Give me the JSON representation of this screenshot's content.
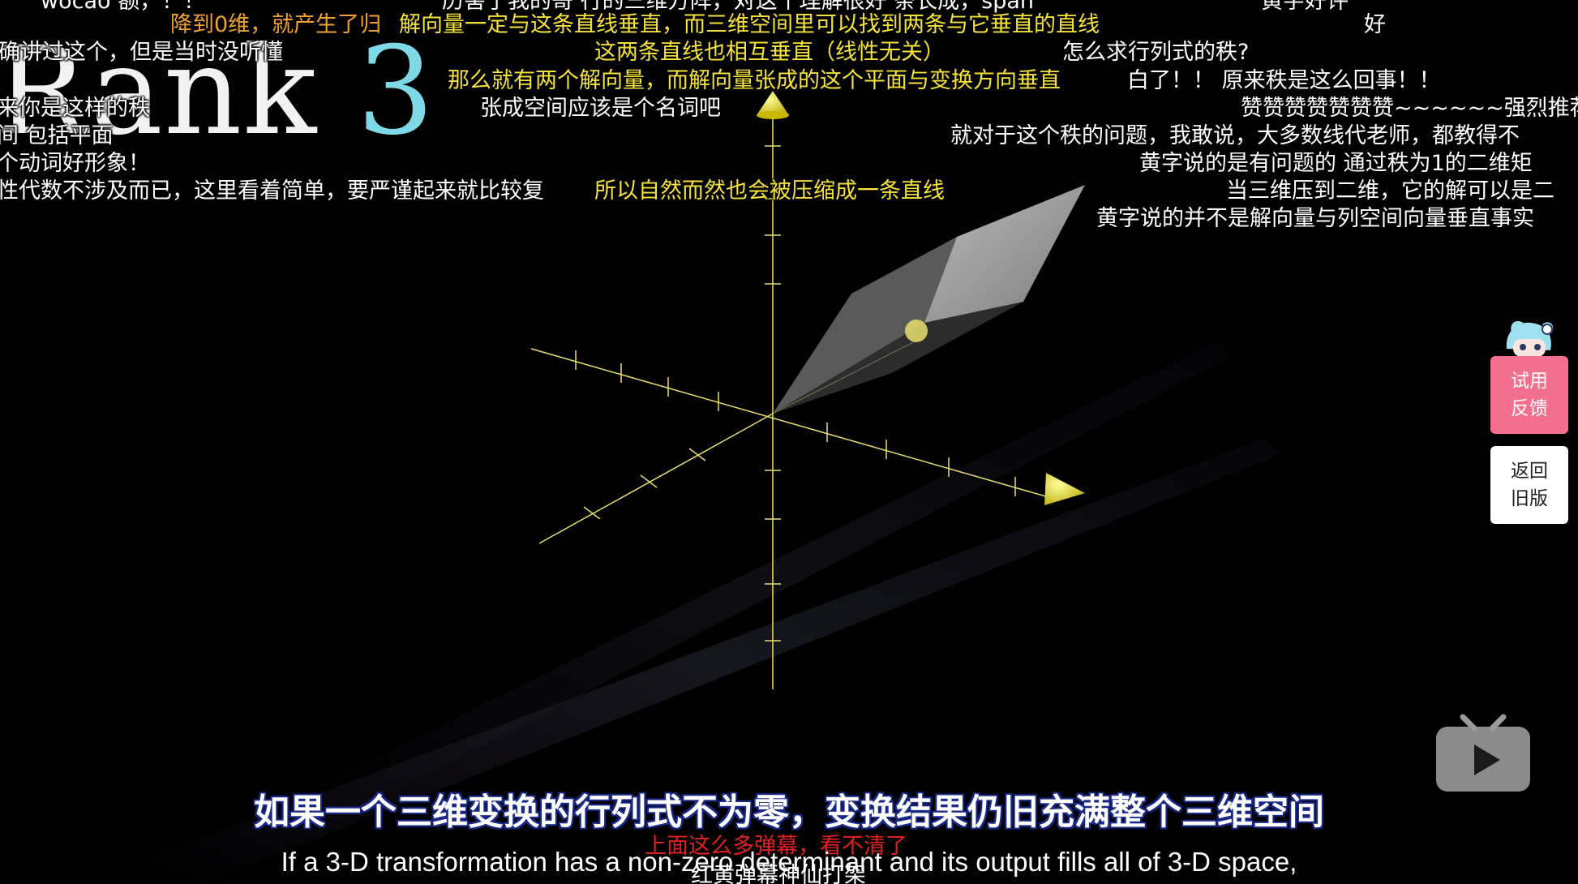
{
  "video": {
    "title_word": "Rank",
    "title_number": "3"
  },
  "danmaku": [
    {
      "text": "wocao  额，！！",
      "color": "white"
    },
    {
      "text": "历害了我的哥 行的三维方阵，对这个理解很好   条长成，span",
      "color": "white"
    },
    {
      "text": "黄字好评",
      "color": "white"
    },
    {
      "text": "降到0维，就产生了归",
      "color": "orange"
    },
    {
      "text": "解向量一定与这条直线垂直，而三维空间里可以找到两条与它垂直的直线",
      "color": "yellow"
    },
    {
      "text": "好",
      "color": "white"
    },
    {
      "text": "确讲过这个，但是当时没听懂",
      "color": "white"
    },
    {
      "text": "这两条直线也相互垂直（线性无关）",
      "color": "yellow"
    },
    {
      "text": "怎么求行列式的秩?",
      "color": "white"
    },
    {
      "text": "那么就有两个解向量，而解向量张成的这个平面与变换方向垂直",
      "color": "yellow"
    },
    {
      "text": "白了！！ 原来秩是这么回事！！",
      "color": "white"
    },
    {
      "text": "来你是这样的秩",
      "color": "white"
    },
    {
      "text": "张成空间应该是个名词吧",
      "color": "white"
    },
    {
      "text": "赞赞赞赞赞赞赞~~~~~~强烈推荐",
      "color": "white"
    },
    {
      "text": "间  包括平面",
      "color": "white"
    },
    {
      "text": "就对于这个秩的问题，我敢说，大多数线代老师，都教得不",
      "color": "white"
    },
    {
      "text": "个动词好形象！",
      "color": "white"
    },
    {
      "text": "黄字说的是有问题的  通过秩为1的二维矩",
      "color": "white"
    },
    {
      "text": "性代数不涉及而已，这里看着简单，要严谨起来就比较复",
      "color": "white"
    },
    {
      "text": "所以自然而然也会被压缩成一条直线",
      "color": "yellow"
    },
    {
      "text": "当三维压到二维，它的解可以是二",
      "color": "white"
    },
    {
      "text": "黄字说的并不是解向量与列空间向量垂直事实",
      "color": "white"
    },
    {
      "text": "上面这么多弹幕，看不清了",
      "color": "red"
    },
    {
      "text": "红黄弹幕神仙打架",
      "color": "white"
    }
  ],
  "subtitles": {
    "chinese": "如果一个三维变换的行列式不为零，变换结果仍旧充满整个三维空间",
    "english": "If a 3-D transformation has a non-zero determinant and its output fills all of 3-D space,"
  },
  "side_buttons": {
    "feedback_label": "试用\n反馈",
    "old_version_label": "返回\n旧版"
  },
  "icons": {
    "mascot": "bilibili-mascot-icon",
    "play": "bilibili-tv-play-icon"
  },
  "colors": {
    "danmaku_yellow": "#f5e23c",
    "danmaku_orange": "#f0a030",
    "danmaku_red": "#e02020",
    "feedback_pink": "#f46f8e",
    "axis_yellow": "#e8e070",
    "title_number": "#7fd8e6"
  }
}
